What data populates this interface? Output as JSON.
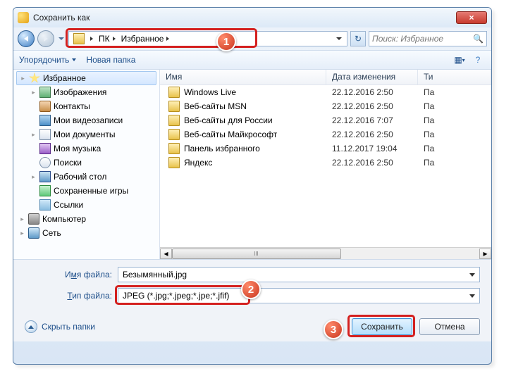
{
  "title": "Сохранить как",
  "close_x": "×",
  "breadcrumb": {
    "pc": "ПК",
    "fav": "Избранное"
  },
  "search_placeholder": "Поиск: Избранное",
  "toolbar": {
    "organize": "Упорядочить",
    "newfolder": "Новая папка"
  },
  "tree": [
    {
      "icon": "i-star",
      "label": "Избранное",
      "exp": "▸",
      "sel": true,
      "lvl": 2
    },
    {
      "icon": "i-pic",
      "label": "Изображения",
      "exp": "▸",
      "lvl": 2
    },
    {
      "icon": "i-contact",
      "label": "Контакты",
      "lvl": 2
    },
    {
      "icon": "i-video",
      "label": "Мои видеозаписи",
      "lvl": 2
    },
    {
      "icon": "i-doc",
      "label": "Мои документы",
      "exp": "▸",
      "lvl": 2
    },
    {
      "icon": "i-music",
      "label": "Моя музыка",
      "lvl": 2
    },
    {
      "icon": "i-search",
      "label": "Поиски",
      "lvl": 2
    },
    {
      "icon": "i-desktop",
      "label": "Рабочий стол",
      "exp": "▸",
      "lvl": 2
    },
    {
      "icon": "i-games",
      "label": "Сохраненные игры",
      "lvl": 2
    },
    {
      "icon": "i-link",
      "label": "Ссылки",
      "lvl": 2
    },
    {
      "icon": "i-computer",
      "label": "Компьютер",
      "exp": "▸",
      "lvl": 1
    },
    {
      "icon": "i-network",
      "label": "Сеть",
      "exp": "▸",
      "lvl": 1
    }
  ],
  "columns": {
    "name": "Имя",
    "date": "Дата изменения",
    "type": "Ти"
  },
  "files": [
    {
      "name": "Windows Live",
      "date": "22.12.2016 2:50",
      "type": "Па"
    },
    {
      "name": "Веб-сайты MSN",
      "date": "22.12.2016 2:50",
      "type": "Па"
    },
    {
      "name": "Веб-сайты для России",
      "date": "22.12.2016 7:07",
      "type": "Па"
    },
    {
      "name": "Веб-сайты Майкрософт",
      "date": "22.12.2016 2:50",
      "type": "Па"
    },
    {
      "name": "Панель избранного",
      "date": "11.12.2017 19:04",
      "type": "Па"
    },
    {
      "name": "Яндекс",
      "date": "22.12.2016 2:50",
      "type": "Па"
    }
  ],
  "filename_label_pre": "И",
  "filename_label_u": "м",
  "filename_label_post": "я файла:",
  "filetype_label_pre": "",
  "filetype_label_u": "Т",
  "filetype_label_post": "ип файла:",
  "filename_value": "Безымянный.jpg",
  "filetype_value": "JPEG (*.jpg;*.jpeg;*.jpe;*.jfif)",
  "hide_folders": "Скрыть папки",
  "save": "Сохранить",
  "cancel": "Отмена",
  "badges": {
    "1": "1",
    "2": "2",
    "3": "3"
  }
}
